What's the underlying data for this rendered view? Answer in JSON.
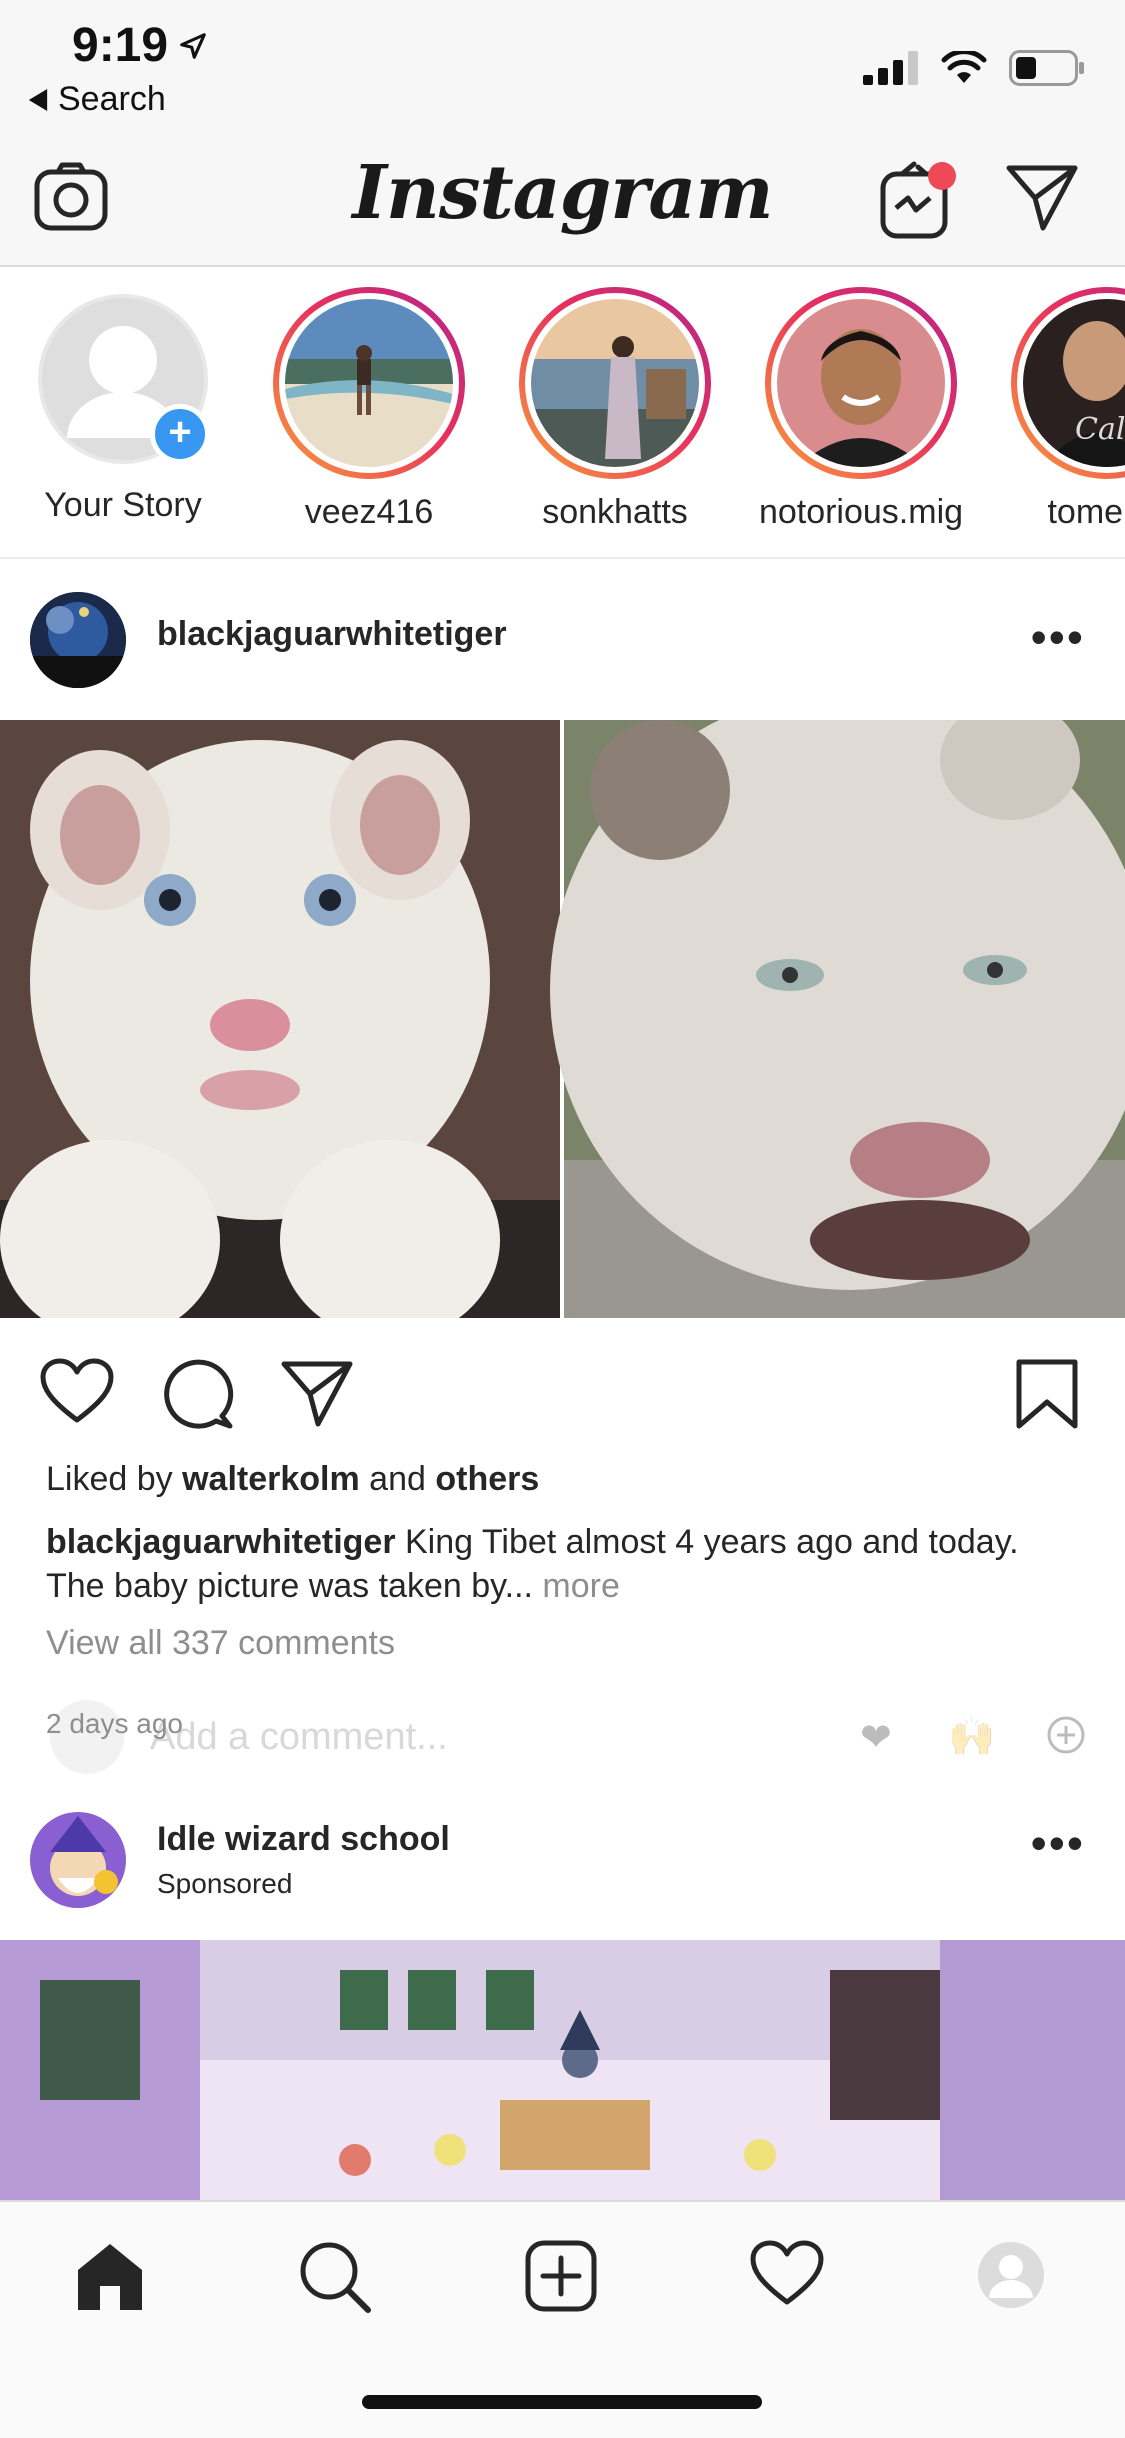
{
  "status_bar": {
    "time": "9:19",
    "back_label": "Search"
  },
  "header": {
    "logo": "Instagram"
  },
  "stories": [
    {
      "username": "Your Story",
      "own": true
    },
    {
      "username": "veez416"
    },
    {
      "username": "sonkhatts"
    },
    {
      "username": "notorious.mig"
    },
    {
      "username": "tomelaz"
    }
  ],
  "post": {
    "username": "blackjaguarwhitetiger",
    "liked_by_prefix": "Liked by",
    "liked_by_user": "walterkolm",
    "liked_by_and": "and",
    "liked_by_others": "others",
    "caption_user": "blackjaguarwhitetiger",
    "caption_text": "King Tibet almost 4 years ago and today. The baby picture was taken by...",
    "more_label": "more",
    "view_all_comments": "View all 337 comments",
    "time_ago": "2 days ago",
    "add_comment_placeholder": "Add a comment..."
  },
  "sponsored_post": {
    "username": "Idle wizard school",
    "subtitle": "Sponsored"
  },
  "colors": {
    "accent_blue": "#3897f0",
    "story_ring_start": "#f9a03c",
    "story_ring_end": "#b2248f",
    "notification_red": "#ed4956"
  },
  "icons": {
    "header": [
      "camera-icon",
      "igtv-icon",
      "direct-message-icon"
    ],
    "actions": [
      "heart-icon",
      "comment-icon",
      "share-icon",
      "bookmark-icon"
    ],
    "tabbar": [
      "home-icon",
      "search-icon",
      "new-post-icon",
      "activity-heart-icon",
      "profile-icon"
    ]
  }
}
